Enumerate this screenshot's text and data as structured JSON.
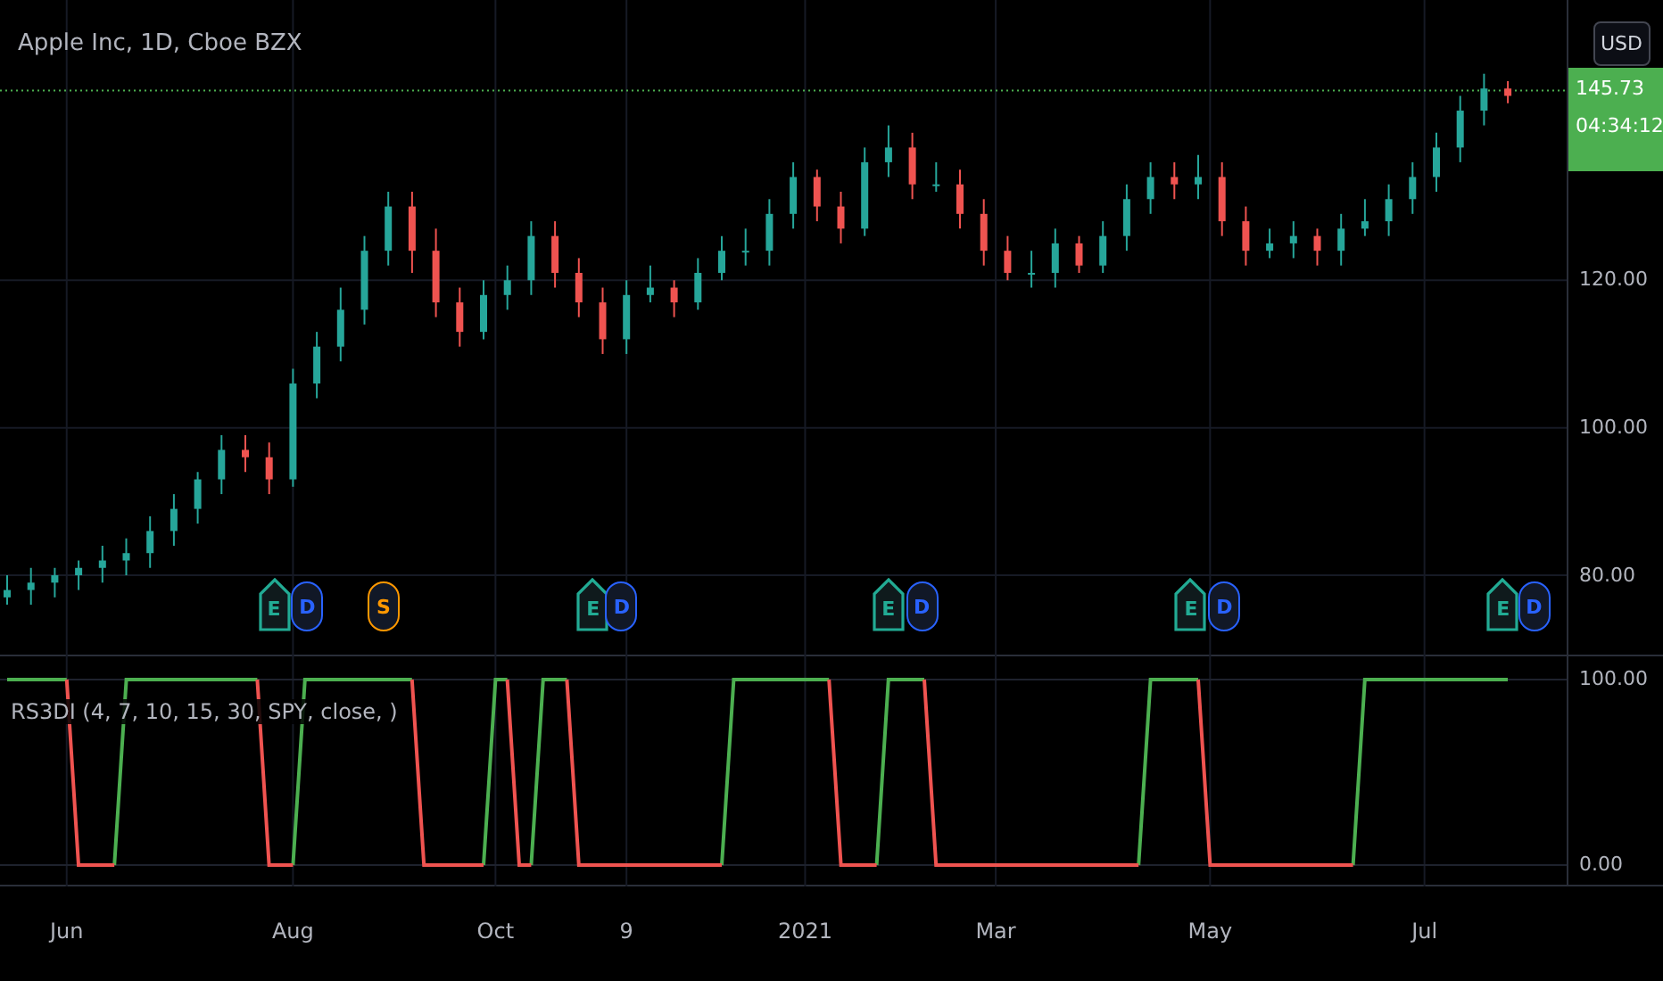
{
  "symbol_title": "Apple Inc, 1D, Cboe BZX",
  "currency": "USD",
  "last_price": {
    "countdown": "04:34:12",
    "color": "#4caf50"
  },
  "price_chart": {
    "chart_data": {
      "type": "candlestick",
      "grid": true,
      "ylim": [
        69,
        158
      ],
      "yticks": [
        {
          "value": 80,
          "label": "80.00"
        },
        {
          "value": 100,
          "label": "100.00"
        },
        {
          "value": 120,
          "label": "120.00"
        }
      ],
      "ref_lines": [
        {
          "axis": "y",
          "value": 145.73,
          "label": "145.73",
          "color": "#4caf50"
        }
      ],
      "series": [
        {
          "ohlc": [
            [
              77,
              80,
              76,
              78
            ],
            [
              78,
              81,
              76,
              79
            ],
            [
              79,
              81,
              77,
              80
            ],
            [
              80,
              82,
              78,
              81
            ],
            [
              81,
              84,
              79,
              82
            ],
            [
              82,
              85,
              80,
              83
            ],
            [
              83,
              88,
              81,
              86
            ],
            [
              86,
              91,
              84,
              89
            ],
            [
              89,
              94,
              87,
              93
            ],
            [
              93,
              99,
              91,
              97
            ],
            [
              97,
              99,
              94,
              96
            ],
            [
              96,
              98,
              91,
              93
            ],
            [
              93,
              108,
              92,
              106
            ],
            [
              106,
              113,
              104,
              111
            ],
            [
              111,
              119,
              109,
              116
            ],
            [
              116,
              126,
              114,
              124
            ],
            [
              124,
              132,
              122,
              130
            ],
            [
              130,
              132,
              121,
              124
            ],
            [
              124,
              127,
              115,
              117
            ],
            [
              117,
              119,
              111,
              113
            ],
            [
              113,
              120,
              112,
              118
            ],
            [
              118,
              122,
              116,
              120
            ],
            [
              120,
              128,
              118,
              126
            ],
            [
              126,
              128,
              119,
              121
            ],
            [
              121,
              123,
              115,
              117
            ],
            [
              117,
              119,
              110,
              112
            ],
            [
              112,
              120,
              110,
              118
            ],
            [
              118,
              122,
              117,
              119
            ],
            [
              119,
              120,
              115,
              117
            ],
            [
              117,
              123,
              116,
              121
            ],
            [
              121,
              126,
              120,
              124
            ],
            [
              124,
              127,
              122,
              124
            ],
            [
              124,
              131,
              122,
              129
            ],
            [
              129,
              136,
              127,
              134
            ],
            [
              134,
              135,
              128,
              130
            ],
            [
              130,
              132,
              125,
              127
            ],
            [
              127,
              138,
              126,
              136
            ],
            [
              136,
              141,
              134,
              138
            ],
            [
              138,
              140,
              131,
              133
            ],
            [
              133,
              136,
              132,
              133
            ],
            [
              133,
              135,
              127,
              129
            ],
            [
              129,
              131,
              122,
              124
            ],
            [
              124,
              126,
              120,
              121
            ],
            [
              121,
              124,
              119,
              121
            ],
            [
              121,
              127,
              119,
              125
            ],
            [
              125,
              126,
              121,
              122
            ],
            [
              122,
              128,
              121,
              126
            ],
            [
              126,
              133,
              124,
              131
            ],
            [
              131,
              136,
              129,
              134
            ],
            [
              134,
              136,
              131,
              133
            ],
            [
              133,
              137,
              131,
              134
            ],
            [
              134,
              136,
              126,
              128
            ],
            [
              128,
              130,
              122,
              124
            ],
            [
              124,
              127,
              123,
              125
            ],
            [
              125,
              128,
              123,
              126
            ],
            [
              126,
              127,
              122,
              124
            ],
            [
              124,
              129,
              122,
              127
            ],
            [
              127,
              131,
              126,
              128
            ],
            [
              128,
              133,
              126,
              131
            ],
            [
              131,
              136,
              129,
              134
            ],
            [
              134,
              140,
              132,
              138
            ],
            [
              138,
              145,
              136,
              143
            ],
            [
              143,
              148,
              141,
              146
            ],
            [
              146,
              147,
              144,
              145
            ]
          ]
        }
      ]
    }
  },
  "events": [
    {
      "kind": "earnings",
      "letter": "E"
    },
    {
      "kind": "dividend",
      "letter": "D"
    },
    {
      "kind": "split",
      "letter": "S"
    },
    {
      "kind": "earnings",
      "letter": "E"
    },
    {
      "kind": "dividend",
      "letter": "D"
    },
    {
      "kind": "earnings",
      "letter": "E"
    },
    {
      "kind": "dividend",
      "letter": "D"
    },
    {
      "kind": "earnings",
      "letter": "E"
    },
    {
      "kind": "dividend",
      "letter": "D"
    },
    {
      "kind": "earnings",
      "letter": "E"
    },
    {
      "kind": "dividend",
      "letter": "D"
    }
  ],
  "indicator": {
    "legend": "RS3DI (4, 7, 10, 15, 30, SPY, close, )",
    "chart_data": {
      "type": "line",
      "grid": true,
      "ylim": [
        -11.5,
        112.5
      ],
      "yticks": [
        {
          "value": 0,
          "label": "0.00"
        },
        {
          "value": 100,
          "label": "100.00"
        }
      ],
      "categories": [
        null,
        null,
        null,
        null,
        null,
        "Jun",
        null,
        null,
        null,
        null,
        null,
        null,
        null,
        null,
        null,
        null,
        null,
        null,
        null,
        null,
        null,
        null,
        null,
        null,
        "Aug",
        null,
        null,
        null,
        null,
        null,
        null,
        null,
        null,
        null,
        null,
        null,
        null,
        null,
        null,
        null,
        null,
        "Oct",
        null,
        null,
        null,
        null,
        null,
        null,
        null,
        null,
        null,
        null,
        "9",
        null,
        null,
        null,
        null,
        null,
        null,
        null,
        null,
        null,
        null,
        null,
        null,
        null,
        null,
        "2021",
        null,
        null,
        null,
        null,
        null,
        null,
        null,
        null,
        null,
        null,
        null,
        null,
        null,
        null,
        null,
        "Mar",
        null,
        null,
        null,
        null,
        null,
        null,
        null,
        null,
        null,
        null,
        null,
        null,
        null,
        null,
        null,
        null,
        null,
        "May",
        null,
        null,
        null,
        null,
        null,
        null,
        null,
        null,
        null,
        null,
        null,
        null,
        null,
        null,
        null,
        null,
        null,
        "Jul",
        null,
        null,
        null,
        null,
        null,
        null,
        null
      ],
      "series": [
        {
          "color": "#4caf50",
          "values": [
            100,
            100,
            100,
            100,
            100,
            100,
            null,
            null,
            null,
            0,
            100,
            100,
            100,
            100,
            100,
            100,
            100,
            100,
            100,
            100,
            100,
            100,
            null,
            null,
            0,
            100,
            100,
            100,
            100,
            100,
            100,
            100,
            100,
            100,
            100,
            null,
            null,
            null,
            null,
            null,
            0,
            100,
            100,
            null,
            0,
            100,
            100,
            100,
            null,
            null,
            null,
            null,
            null,
            null,
            null,
            null,
            null,
            null,
            null,
            null,
            0,
            100,
            100,
            100,
            100,
            100,
            100,
            100,
            100,
            100,
            null,
            null,
            null,
            0,
            100,
            100,
            100,
            100,
            null,
            null,
            null,
            null,
            null,
            null,
            null,
            null,
            null,
            null,
            null,
            null,
            null,
            null,
            null,
            null,
            null,
            0,
            100,
            100,
            100,
            100,
            100,
            null,
            null,
            null,
            null,
            null,
            null,
            null,
            null,
            null,
            null,
            null,
            null,
            0,
            100,
            100,
            100,
            100,
            100,
            100,
            100,
            100,
            100,
            100,
            100,
            100,
            100
          ]
        },
        {
          "color": "#ef5350",
          "values": [
            null,
            null,
            null,
            null,
            null,
            100,
            0,
            0,
            0,
            0,
            null,
            null,
            null,
            null,
            null,
            null,
            null,
            null,
            null,
            null,
            null,
            100,
            0,
            0,
            0,
            null,
            null,
            null,
            null,
            null,
            null,
            null,
            null,
            null,
            100,
            0,
            0,
            0,
            0,
            0,
            0,
            null,
            100,
            0,
            0,
            null,
            null,
            100,
            0,
            0,
            0,
            0,
            0,
            0,
            0,
            0,
            0,
            0,
            0,
            0,
            0,
            null,
            null,
            null,
            null,
            null,
            null,
            null,
            null,
            100,
            0,
            0,
            0,
            0,
            null,
            null,
            null,
            100,
            0,
            0,
            0,
            0,
            0,
            0,
            0,
            0,
            0,
            0,
            0,
            0,
            0,
            0,
            0,
            0,
            0,
            0,
            null,
            null,
            null,
            null,
            100,
            0,
            0,
            0,
            0,
            0,
            0,
            0,
            0,
            0,
            0,
            0,
            0,
            0,
            null,
            null,
            null,
            null,
            null,
            null,
            null,
            null,
            null,
            null,
            null,
            null,
            null
          ]
        }
      ]
    }
  }
}
